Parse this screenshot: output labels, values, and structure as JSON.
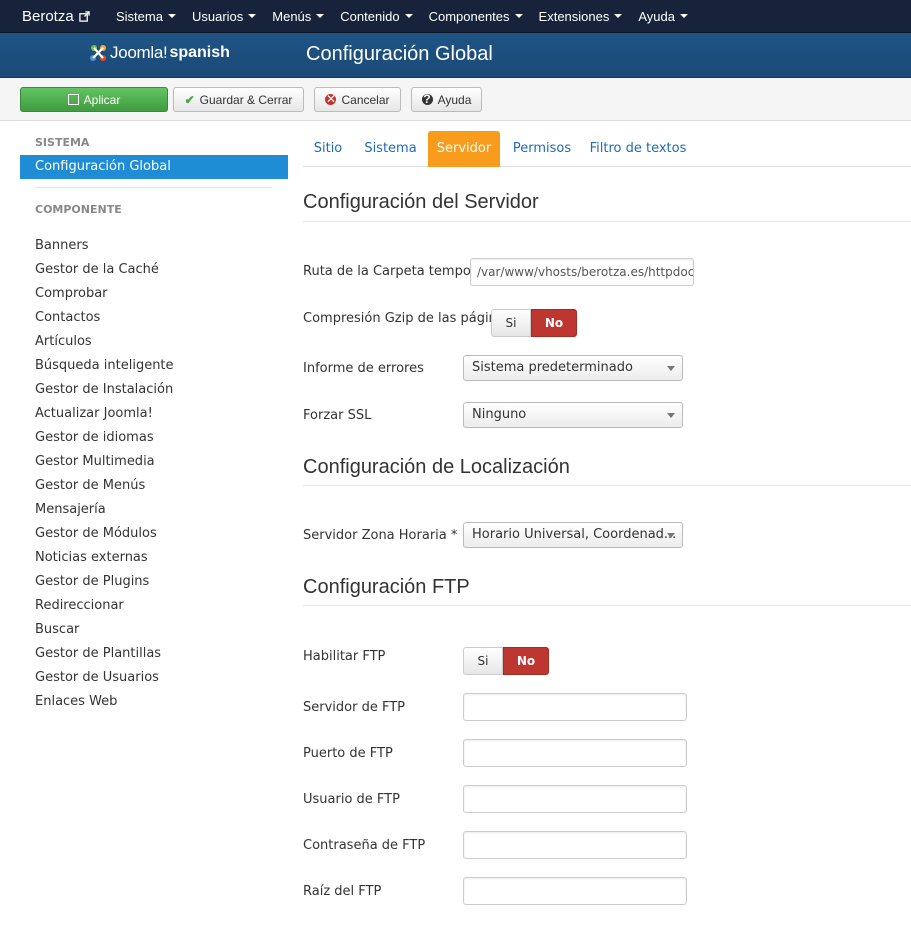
{
  "navbar": {
    "brand": "Berotza",
    "menus": [
      "Sistema",
      "Usuarios",
      "Menús",
      "Contenido",
      "Componentes",
      "Extensiones",
      "Ayuda"
    ]
  },
  "header": {
    "logo_text": "Joomla!",
    "logo_sub": "spanish",
    "title": "Configuración Global"
  },
  "toolbar": {
    "apply": "Aplicar",
    "save_close": "Guardar & Cerrar",
    "cancel": "Cancelar",
    "help": "Ayuda"
  },
  "sidebar": {
    "system_heading": "SISTEMA",
    "active_item": "Configuración Global",
    "component_heading": "COMPONENTE",
    "items": [
      "Banners",
      "Gestor de la Caché",
      "Comprobar",
      "Contactos",
      "Artículos",
      "Búsqueda inteligente",
      "Gestor de Instalación",
      "Actualizar Joomla!",
      "Gestor de idiomas",
      "Gestor Multimedia",
      "Gestor de Menús",
      "Mensajería",
      "Gestor de Módulos",
      "Noticias externas",
      "Gestor de Plugins",
      "Redireccionar",
      "Buscar",
      "Gestor de Plantillas",
      "Gestor de Usuarios",
      "Enlaces Web"
    ]
  },
  "tabs": [
    "Sitio",
    "Sistema",
    "Servidor",
    "Permisos",
    "Filtro de textos"
  ],
  "active_tab": "Servidor",
  "server": {
    "title": "Configuración del Servidor",
    "tmp_label": "Ruta de la Carpeta temporal",
    "tmp_value": "/var/www/vhosts/berotza.es/httpdocs",
    "gzip_label": "Compresión Gzip de las páginas",
    "error_label": "Informe de errores",
    "error_value": "Sistema predeterminado",
    "ssl_label": "Forzar SSL",
    "ssl_value": "Ninguno"
  },
  "locale": {
    "title": "Configuración de Localización",
    "tz_label": "Servidor Zona Horaria *",
    "tz_value": "Horario Universal, Coordenad..."
  },
  "ftp": {
    "title": "Configuración FTP",
    "enable_label": "Habilitar FTP",
    "host_label": "Servidor de FTP",
    "port_label": "Puerto de FTP",
    "user_label": "Usuario de FTP",
    "pass_label": "Contraseña de FTP",
    "root_label": "Raíz del FTP",
    "host_value": "",
    "port_value": "",
    "user_value": "",
    "pass_value": "",
    "root_value": ""
  },
  "toggle": {
    "yes": "Si",
    "no": "No"
  },
  "colors": {
    "navbar": "#17233b",
    "header": "#1f5485",
    "active_tab": "#f99b1c",
    "active_side": "#1f8dd6",
    "no_toggle": "#bd362f",
    "apply": "#46a546"
  }
}
